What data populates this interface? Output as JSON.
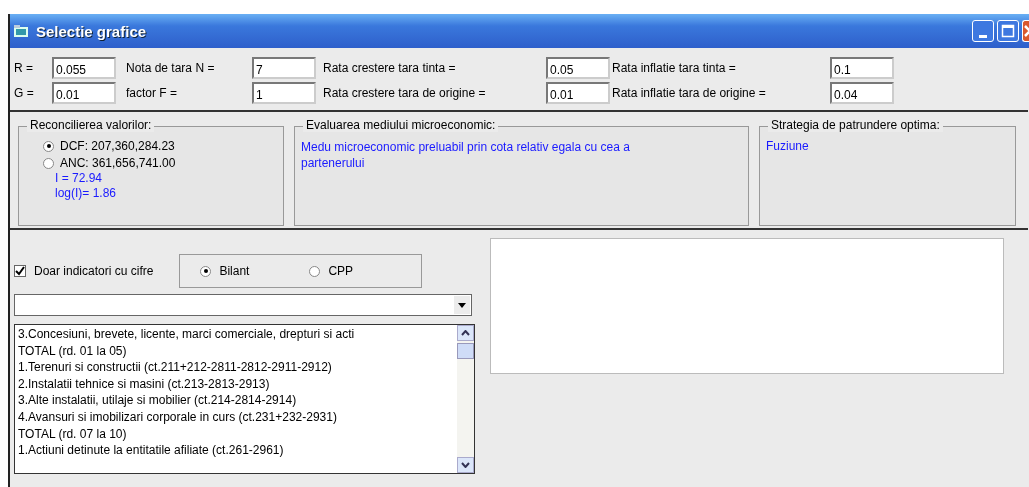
{
  "window": {
    "title": "Selectie grafice"
  },
  "parameters": [
    {
      "label": "R =",
      "value": "0.055"
    },
    {
      "label": "Nota de tara N =",
      "value": "7"
    },
    {
      "label": "Rata crestere tara tinta =",
      "value": "0.05"
    },
    {
      "label": "Rata inflatie tara tinta =",
      "value": "0.1"
    },
    {
      "label": "G =",
      "value": "0.01"
    },
    {
      "label": "factor F =",
      "value": "1"
    },
    {
      "label": "Rata crestere tara de origine =",
      "value": "0.01"
    },
    {
      "label": "Rata inflatie tara de origine =",
      "value": "0.04"
    }
  ],
  "reconciliation": {
    "title": "Reconcilierea valorilor:",
    "options": [
      {
        "label": "DCF: 207,360,284.23",
        "selected": true
      },
      {
        "label": "ANC: 361,656,741.00",
        "selected": false
      }
    ],
    "results": [
      "I = 72.94",
      "log(I)= 1.86"
    ]
  },
  "microeconomic": {
    "title": "Evaluarea mediului microeconomic:",
    "text": "Medu microeconomic preluabil prin cota relativ egala cu cea a partenerului"
  },
  "strategy": {
    "title": "Strategia de patrundere optima:",
    "text": "Fuziune"
  },
  "filter_checkbox": {
    "label": "Doar indicatori cu cifre",
    "checked": true
  },
  "report_type": [
    {
      "label": "Bilant",
      "selected": true
    },
    {
      "label": "CPP",
      "selected": false
    }
  ],
  "indicator_list": [
    {
      "label": "3.Concesiuni, brevete, licente, marci comerciale, drepturi si acti",
      "selected": false
    },
    {
      "label": "TOTAL (rd. 01 la 05)",
      "selected": false
    },
    {
      "label": "1.Terenuri si constructii (ct.211+212-2811-2812-2911-2912)",
      "selected": false
    },
    {
      "label": "2.Instalatii tehnice si masini (ct.213-2813-2913)",
      "selected": false
    },
    {
      "label": "3.Alte instalatii, utilaje si mobilier (ct.214-2814-2914)",
      "selected": false
    },
    {
      "label": "4.Avansuri si imobilizari corporale in curs (ct.231+232-2931)",
      "selected": false
    },
    {
      "label": "TOTAL (rd. 07 la 10)",
      "selected": false
    },
    {
      "label": "1.Actiuni detinute la entitatile afiliate (ct.261-2961)",
      "selected": false
    }
  ]
}
